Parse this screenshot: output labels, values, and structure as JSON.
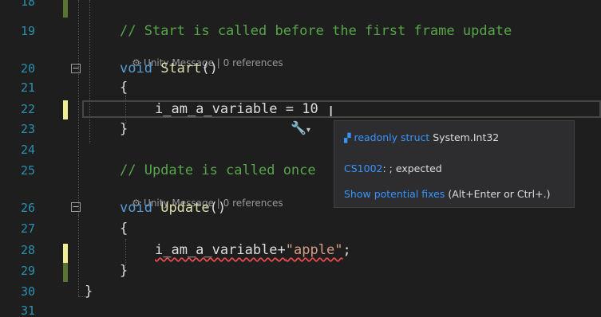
{
  "line_numbers": [
    "18",
    "19",
    "20",
    "21",
    "22",
    "23",
    "24",
    "25",
    "26",
    "27",
    "28",
    "29",
    "30",
    "31"
  ],
  "code": {
    "l19": "// Start is called before the first frame update",
    "meta_start": {
      "icon": "unity-icon",
      "text": "Unity Message | 0 references"
    },
    "l20_kw": "void",
    "l20_fn": "Start",
    "l20_rest": "()",
    "l21": "{",
    "l22_ident": "i_am_a_variable",
    "l22_rest": " = 10",
    "l23": "}",
    "l25": "// Update is called once",
    "meta_update": {
      "icon": "unity-icon",
      "text": "Unity Message | 0 references"
    },
    "l26_kw": "void",
    "l26_fn": "Update",
    "l26_rest": "()",
    "l27": "{",
    "l28_ident": "i_am_a_variable",
    "l28_op": "+",
    "l28_str": "\"apple\"",
    "l28_end": ";",
    "l29": "}",
    "l30": "}"
  },
  "quick_actions": {
    "icon": "screwdriver-icon",
    "chevron": "▾"
  },
  "tooltip": {
    "type_icon": "struct-icon",
    "type_kw": "readonly struct",
    "type_name": "System.Int32",
    "error_code": "CS1002",
    "error_msg": ": ; expected",
    "fix_link": "Show potential fixes",
    "fix_shortcut": " (Alt+Enter or Ctrl+.)"
  },
  "colors": {
    "background": "#1e1e1e",
    "keyword": "#569cd6",
    "comment": "#57a64a",
    "string": "#d69d85",
    "line_number": "#2b91af",
    "change_unsaved": "#efef91",
    "change_saved": "#577430",
    "link": "#3794ff"
  }
}
